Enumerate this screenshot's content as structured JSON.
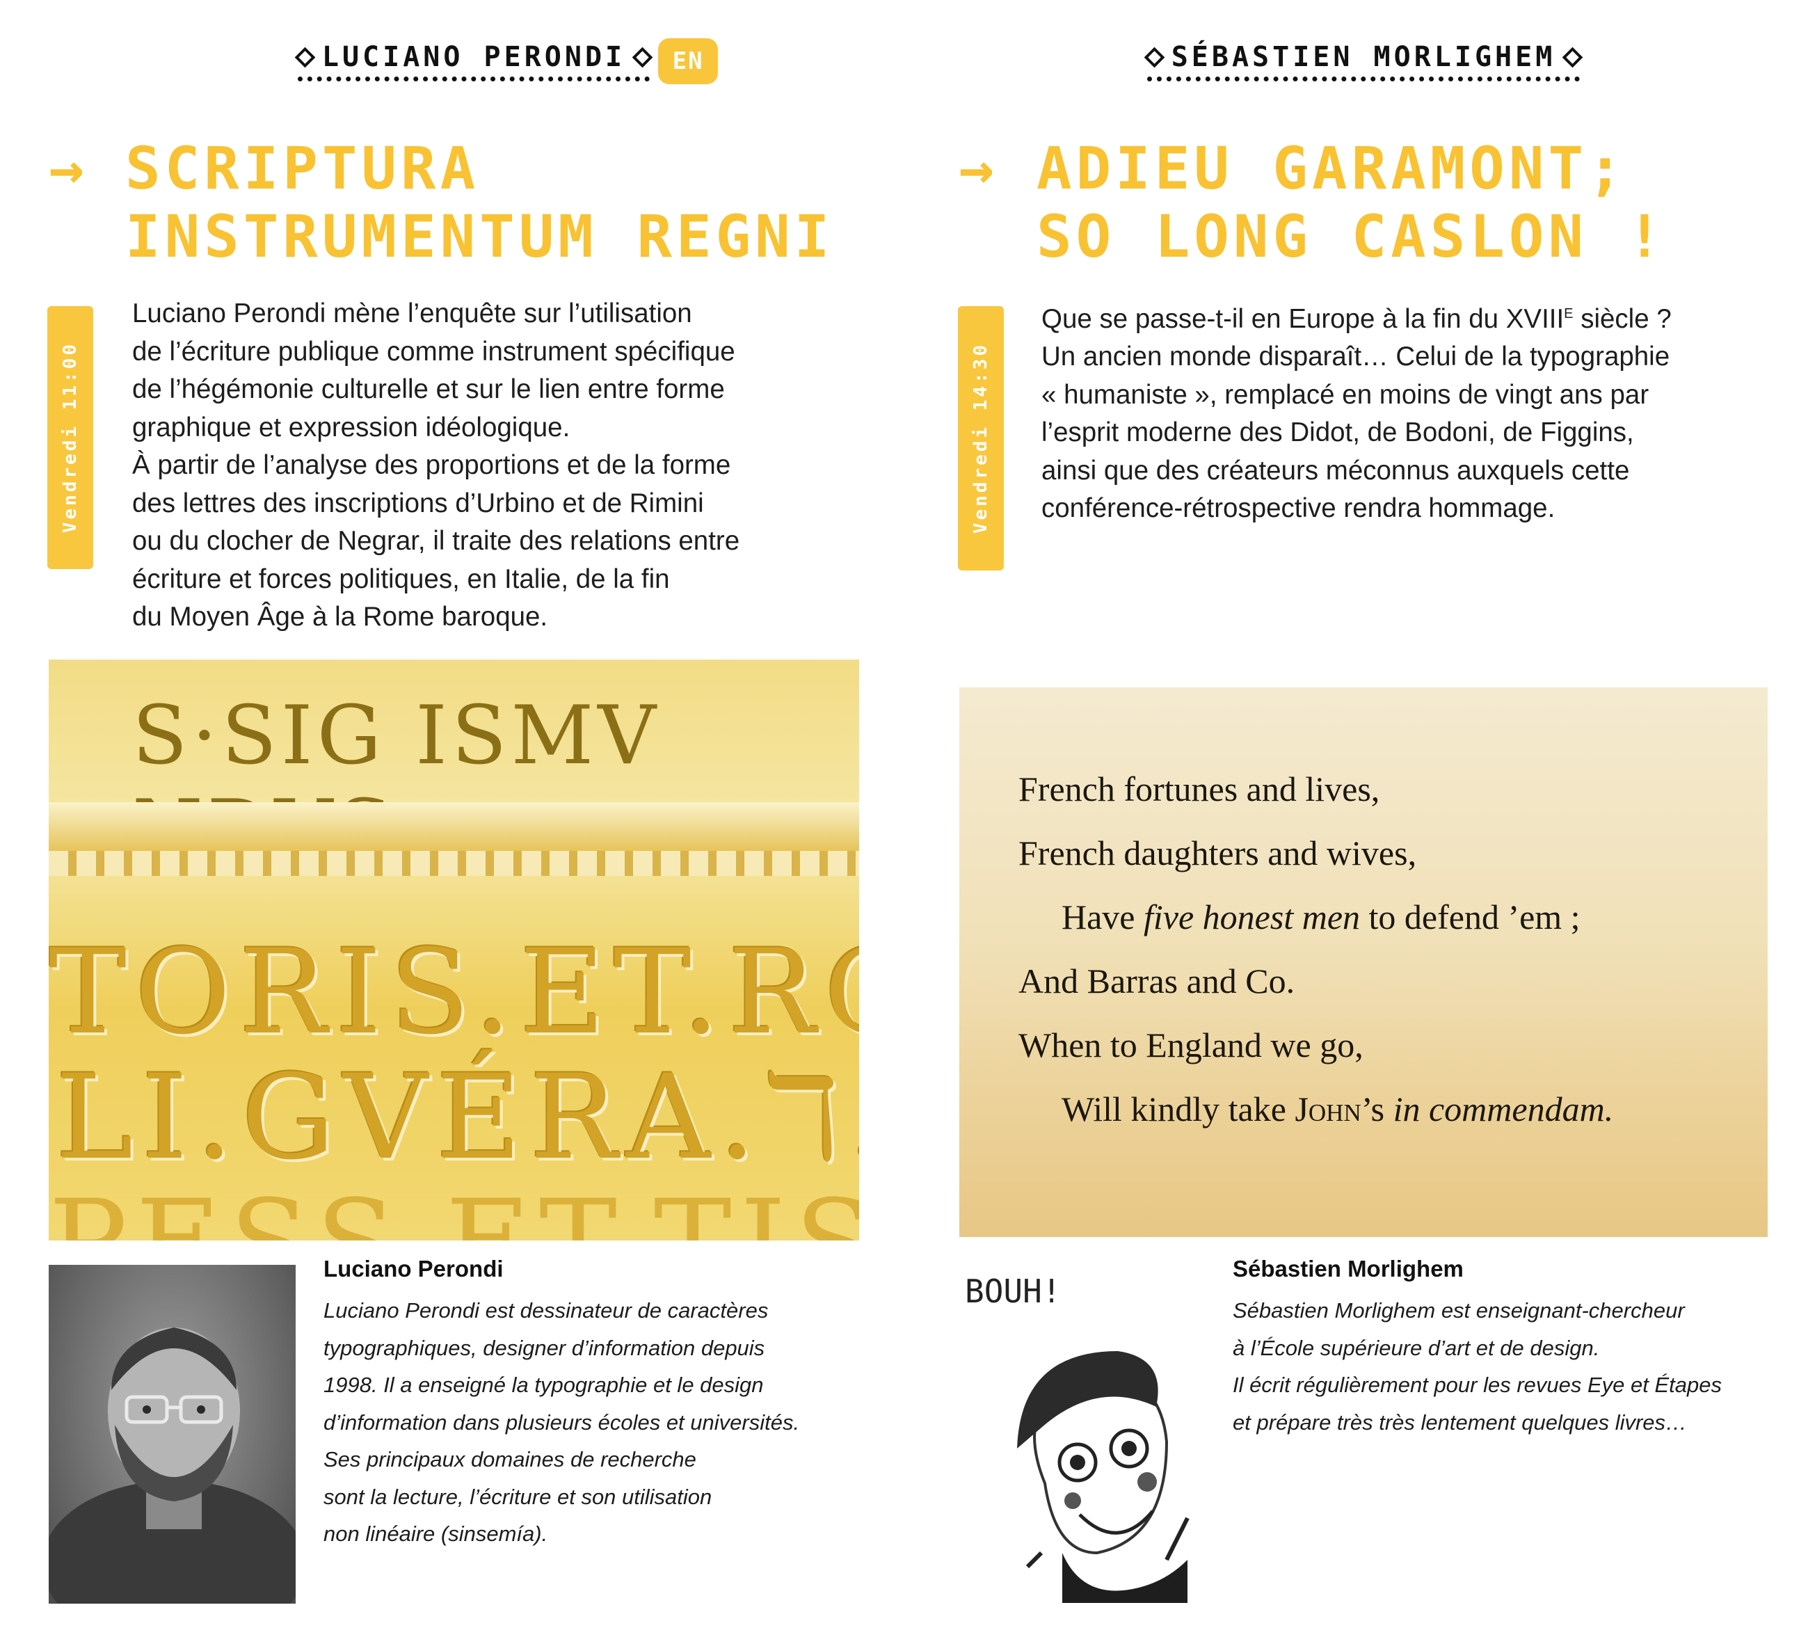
{
  "left": {
    "speaker_label": "Luciano Perondi",
    "lang_badge": "EN",
    "title_line1": "Scriptura",
    "title_line2": "instrumentum regni",
    "arrow": "→",
    "day_badge": "Vendredi 11:00",
    "abstract": [
      "Luciano Perondi mène l’enquête sur l’utilisation",
      "de l’écriture publique comme instrument spécifique",
      "de l’hégémonie culturelle et sur le lien entre forme",
      "graphique et expression idéologique.",
      "À partir de l’analyse des proportions et de la forme",
      "des lettres des inscriptions d’Urbino et de Rimini",
      "ou du clocher de Negrar, il traite des relations entre",
      "écriture et forces politiques, en Italie, de la fin",
      "du Moyen Âge à la Rome baroque."
    ],
    "image_text": {
      "row1": "S·SIG ISMV NDVS",
      "row2": "TORIS.ET.RO",
      "row3": "LI.GVÉRA.ℸ.H",
      "row4": "PESS.ET.TIS"
    },
    "bio_name": "Luciano Perondi",
    "bio": [
      "Luciano Perondi est dessinateur de caractères",
      "typographiques, designer d’information depuis",
      "1998. Il a enseigné la typographie et le design",
      "d’information dans plusieurs écoles et universités.",
      "Ses principaux domaines de recherche",
      "sont la lecture, l’écriture et son utilisation",
      "non linéaire (sinsemía)."
    ]
  },
  "right": {
    "speaker_label": "Sébastien Morlighem",
    "title_line1": "Adieu Garamont;",
    "title_line2": "so long Caslon !",
    "arrow": "→",
    "day_badge": "Vendredi 14:30",
    "abstract_line1_pre": "Que se passe-t-il en Europe à la fin du XVIII",
    "abstract_line1_sup": "E",
    "abstract_line1_post": " siècle ?",
    "abstract": [
      "Un ancien monde disparaît… Celui de la typographie",
      "« humaniste », remplacé en moins de vingt ans par",
      "l’esprit moderne des Didot, de Bodoni, de Figgins,",
      "ainsi que des créateurs méconnus auxquels cette",
      "conférence-rétrospective rendra hommage."
    ],
    "poem": {
      "l1": "French fortunes and lives,",
      "l2": "French daughters and wives,",
      "l3_a": "Have ",
      "l3_b": "five honest men",
      "l3_c": " to defend ’em ;",
      "l4": "And Barras and Co.",
      "l5": "When to England we go,",
      "l6_a": "Will kindly take ",
      "l6_b": "John",
      "l6_c": "’s ",
      "l6_d": "in commendam."
    },
    "drawing_caption": "BOUH!",
    "bio_name": "Sébastien Morlighem",
    "bio": [
      "Sébastien Morlighem est enseignant-chercheur",
      "à l’École supérieure d’art et de design.",
      "Il écrit régulièrement pour les revues Eye et Étapes",
      "et prépare très très lentement quelques livres…"
    ]
  },
  "colors": {
    "accent_yellow": "#f8c233",
    "text": "#1d1d1d"
  }
}
